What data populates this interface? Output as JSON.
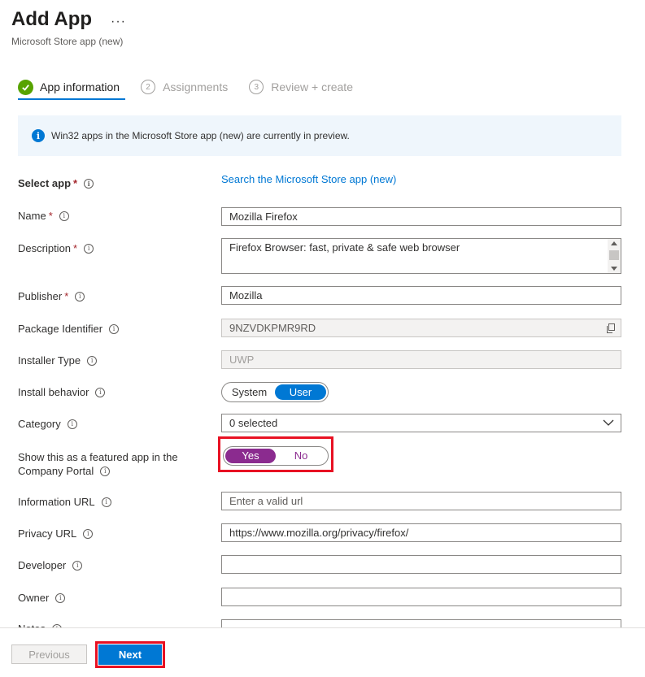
{
  "header": {
    "title": "Add App",
    "more": "···",
    "subtitle": "Microsoft Store app (new)"
  },
  "steps": [
    {
      "label": "App information",
      "state": "done"
    },
    {
      "num": "2",
      "label": "Assignments"
    },
    {
      "num": "3",
      "label": "Review + create"
    }
  ],
  "info": {
    "text": "Win32 apps in the Microsoft Store app (new) are currently in preview.",
    "glyph": "i"
  },
  "form": {
    "select_app": {
      "label": "Select app",
      "link": "Search the Microsoft Store app (new)"
    },
    "name": {
      "label": "Name",
      "value": "Mozilla Firefox"
    },
    "description": {
      "label": "Description",
      "value": "Firefox Browser: fast, private & safe web browser"
    },
    "publisher": {
      "label": "Publisher",
      "value": "Mozilla"
    },
    "package_identifier": {
      "label": "Package Identifier",
      "value": "9NZVDKPMR9RD"
    },
    "installer_type": {
      "label": "Installer Type",
      "value": "UWP"
    },
    "install_behavior": {
      "label": "Install behavior",
      "options": [
        "System",
        "User"
      ],
      "selected": "User"
    },
    "category": {
      "label": "Category",
      "value": "0 selected"
    },
    "featured": {
      "label_line1": "Show this as a featured app in the",
      "label_line2": "Company Portal",
      "options": [
        "Yes",
        "No"
      ],
      "selected": "Yes"
    },
    "information_url": {
      "label": "Information URL",
      "placeholder": "Enter a valid url"
    },
    "privacy_url": {
      "label": "Privacy URL",
      "value": "https://www.mozilla.org/privacy/firefox/"
    },
    "developer": {
      "label": "Developer",
      "value": ""
    },
    "owner": {
      "label": "Owner",
      "value": ""
    },
    "notes": {
      "label": "Notes"
    },
    "required_mark": "*",
    "tip_glyph": "i"
  },
  "footer": {
    "previous": "Previous",
    "next": "Next"
  },
  "colors": {
    "accent": "#0078d4",
    "success": "#57a300",
    "featured_purple": "#8b2b8f",
    "highlight_red": "#e81123"
  }
}
